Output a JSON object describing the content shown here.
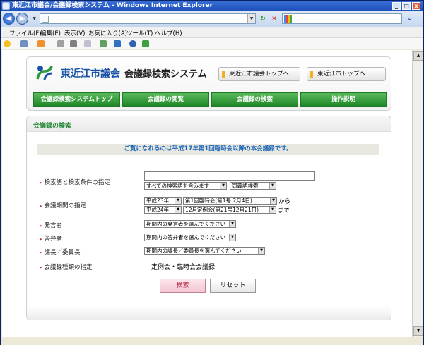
{
  "window": {
    "title": "東近江市議会/会議録検索システム - Windows Internet Explorer",
    "min": "_",
    "max": "□",
    "close": "x"
  },
  "browser": {
    "back": "◀",
    "forward": "▶",
    "go": "↻",
    "stop": "✕",
    "search_go": "⌕"
  },
  "menu": [
    "ファイル(F)",
    "編集(E)",
    "表示(V)",
    "お気に入り(A)",
    "ツール(T)",
    "ヘルプ(H)"
  ],
  "site": {
    "council_name": "東近江市議会",
    "system_name": "会議録検索システム",
    "link_council_top": "東近江市議会トップへ",
    "link_city_top": "東近江市トップへ"
  },
  "nav": [
    "会議録検索システムトップ",
    "会議録の閲覧",
    "会議録の検索",
    "操作説明"
  ],
  "panel": {
    "title": "会議録の検索",
    "notice": "ご覧になれるのは平成17年第1回臨時会以降の本会議録です。"
  },
  "form": {
    "keyword_label": "検索語と検索条件の指定",
    "keyword_value": "",
    "keyword_condition": "すべての検索語を含みます",
    "synonym": "同義語検索",
    "period_label": "会議期間の指定",
    "from_year": "平成23年",
    "from_session": "第1回臨時会(第1号 2月4日)",
    "from_suffix": "から",
    "to_year": "平成24年",
    "to_session": "12月定例会(第21号12月21日)",
    "to_suffix": "まで",
    "speaker_label": "発言者",
    "speaker_value": "期間内の発言者を選んでください",
    "answerer_label": "答弁者",
    "answerer_value": "期間内の答弁者を選んでください",
    "chair_label": "議長／委員長",
    "chair_value": "期間内の議長／委員長を選んでください",
    "type_label": "会議録種類の指定",
    "type_value": "定例会・臨時会会議録",
    "search_button": "検索",
    "reset_button": "リセット"
  },
  "colors": {
    "accent_green": "#2a8a3a",
    "nav_green": "#20882a",
    "notice_blue": "#1a64b8",
    "brand_blue": "#1a52a8"
  }
}
